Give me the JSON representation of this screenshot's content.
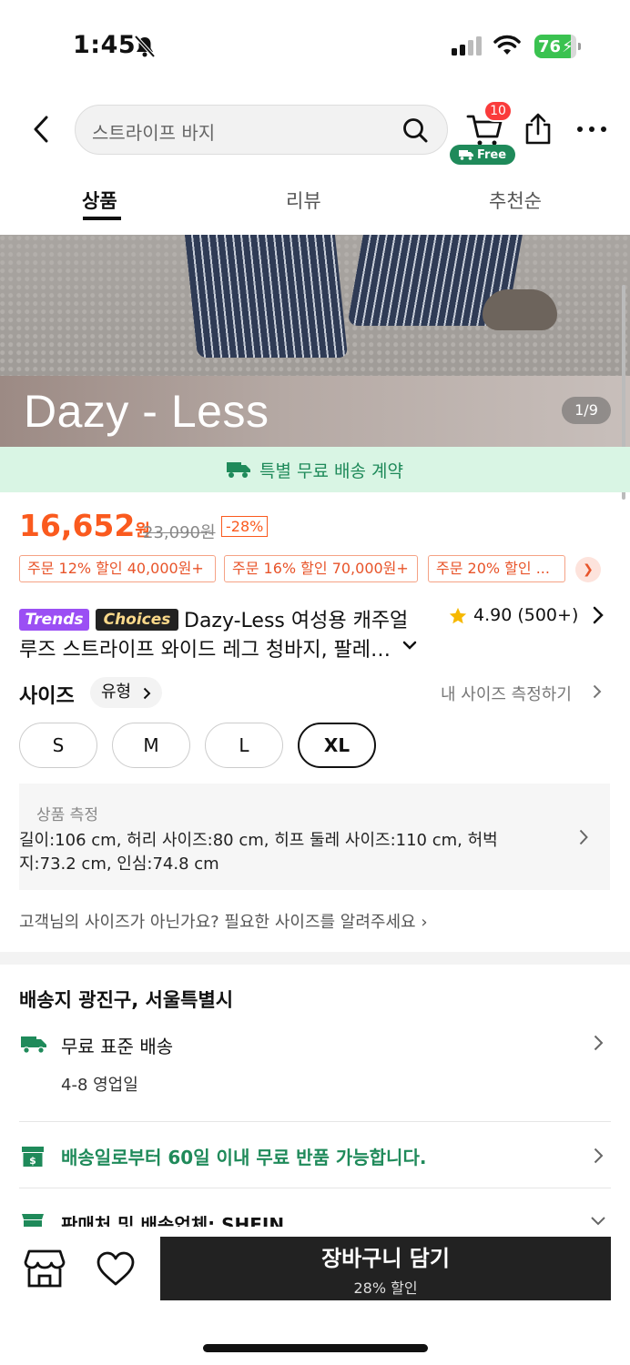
{
  "status_bar": {
    "time": "1:45",
    "battery": "76"
  },
  "header": {
    "search_placeholder": "스트라이프 바지",
    "cart_count": "10",
    "free_label": "Free"
  },
  "tabs": [
    {
      "label": "상품",
      "active": true
    },
    {
      "label": "리뷰",
      "active": false
    },
    {
      "label": "추천순",
      "active": false
    }
  ],
  "gallery": {
    "brand_overlay": "Dazy - Less",
    "counter": "1/9"
  },
  "shipping_banner": "특별 무료 배송 계약",
  "price": {
    "current": "16,652",
    "currency": "원",
    "original": "23,090원",
    "discount": "-28%"
  },
  "coupons": [
    "주문 12% 할인 40,000원+",
    "주문 16% 할인 70,000원+",
    "주문 20% 할인 ..."
  ],
  "product": {
    "badge_trends": "Trends",
    "badge_choices": "Choices",
    "title_line1": "Dazy-Less 여성용 캐주얼",
    "title_line2": "루즈 스트라이프 와이드 레그 청바지, 팔레…",
    "rating": "4.90 (500+)"
  },
  "size": {
    "label": "사이즈",
    "type_chip": "유형",
    "measure_link": "내 사이즈 측정하기",
    "options": [
      "S",
      "M",
      "L",
      "XL"
    ],
    "selected": "XL",
    "measure_title": "상품 측정",
    "measure_text": "길이:106 cm, 허리 사이즈:80 cm, 히프 둘레 사이즈:110 cm, 허벅지:73.2 cm, 인심:74.8 cm",
    "request_text": "고객님의 사이즈가 아닌가요? 필요한 사이즈를 알려주세요 ›"
  },
  "delivery": {
    "destination": "배송지 광진구, 서울특별시",
    "method": "무료 표준 배송",
    "days": "4-8 영업일",
    "returns": "배송일로부터 60일 이내 무료 반품 가능합니다.",
    "seller": "판매처 및 배송업체: SHEIN"
  },
  "bottom": {
    "cart_button": "장바구니 담기",
    "cart_sub": "28% 할인"
  },
  "colors": {
    "price_orange": "#fa5a1e",
    "green": "#1f8a5a",
    "banner_green_bg": "#d9f5e4",
    "badge_red": "#fa3b3b",
    "trends_purple": "#9b4ff4"
  }
}
